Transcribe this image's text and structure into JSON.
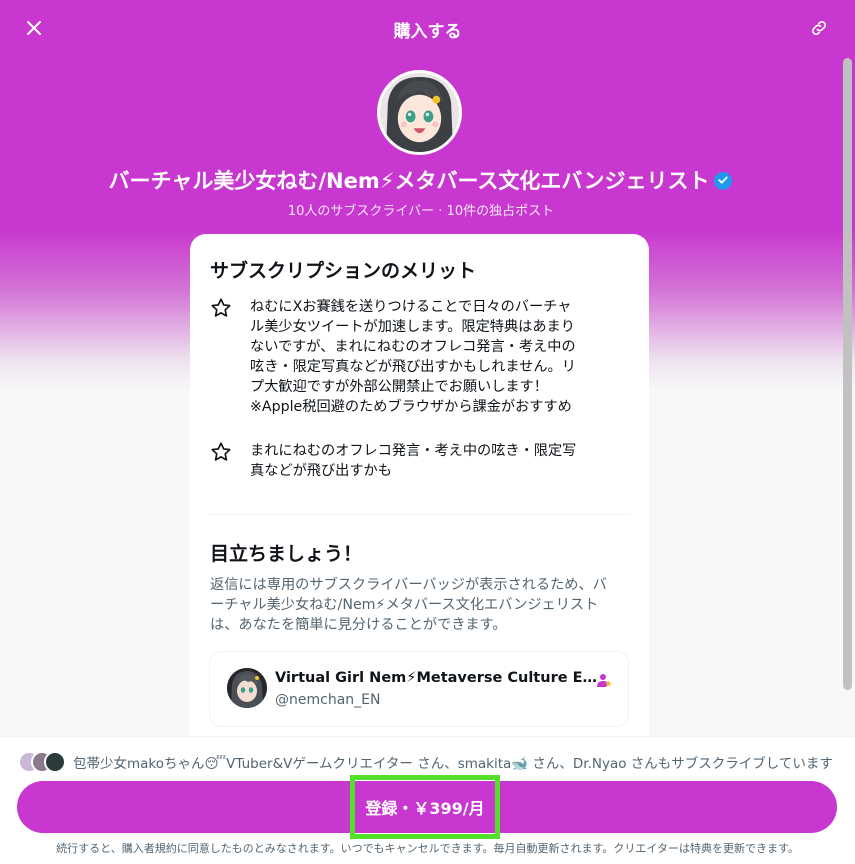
{
  "header": {
    "title": "購入する",
    "close_icon": "close-icon",
    "link_icon": "link-icon"
  },
  "creator": {
    "name": "バーチャル美少女ねむ/Nem⚡メタバース文化エバンジェリスト",
    "stats": "10人のサブスクライバー · 10件の独占ポスト",
    "verified_icon": "verified-badge-icon"
  },
  "card": {
    "benefits_heading": "サブスクリプションのメリット",
    "benefits": [
      {
        "icon": "star-icon",
        "lines": [
          "ねむにXお賽銭を送りつけることで日々のバーチャ",
          "ル美少女ツイートが加速します。限定特典はあまり",
          "ないですが、まれにねむのオフレコ発言・考え中の",
          "呟き・限定写真などが飛び出すかもしれません。リ",
          "プ大歓迎ですが外部公開禁止でお願いします！",
          "※Apple税回避のためブラウザから課金がおすすめ"
        ]
      },
      {
        "icon": "star-icon",
        "lines": [
          "まれにねむのオフレコ発言・考え中の呟き・限定写",
          "真などが飛び出すかも"
        ]
      }
    ],
    "standout_heading": "目立ちましょう！",
    "standout_lines": [
      "返信には専用のサブスクライバーバッジが表示されるため、バ",
      "ーチャル美少女ねむ/Nem⚡メタバース文化エバンジェリスト",
      "は、あなたを簡単に見分けることができます。"
    ],
    "preview": {
      "name": "Virtual Girl Nem⚡Metaverse Culture Evan...",
      "handle": "@nemchan_EN",
      "badge_icon": "subscriber-badge-icon"
    }
  },
  "footer": {
    "subscribers_text": "包帯少女makoちゃん😴VTuber&Vゲームクリエイター さん、smakita🐋 さん、Dr.Nyao さんもサブスクライブしています",
    "subscribe_label": "登録・￥399/月",
    "legal": "続行すると、購入者規約に同意したものとみなされます。いつでもキャンセルできます。毎月自動更新されます。クリエイターは特典を更新できます。"
  },
  "colors": {
    "brand": "#c837cf",
    "highlight": "#52e02a",
    "verified": "#1d9bf0",
    "subscriber_badge": "#c837cf"
  }
}
